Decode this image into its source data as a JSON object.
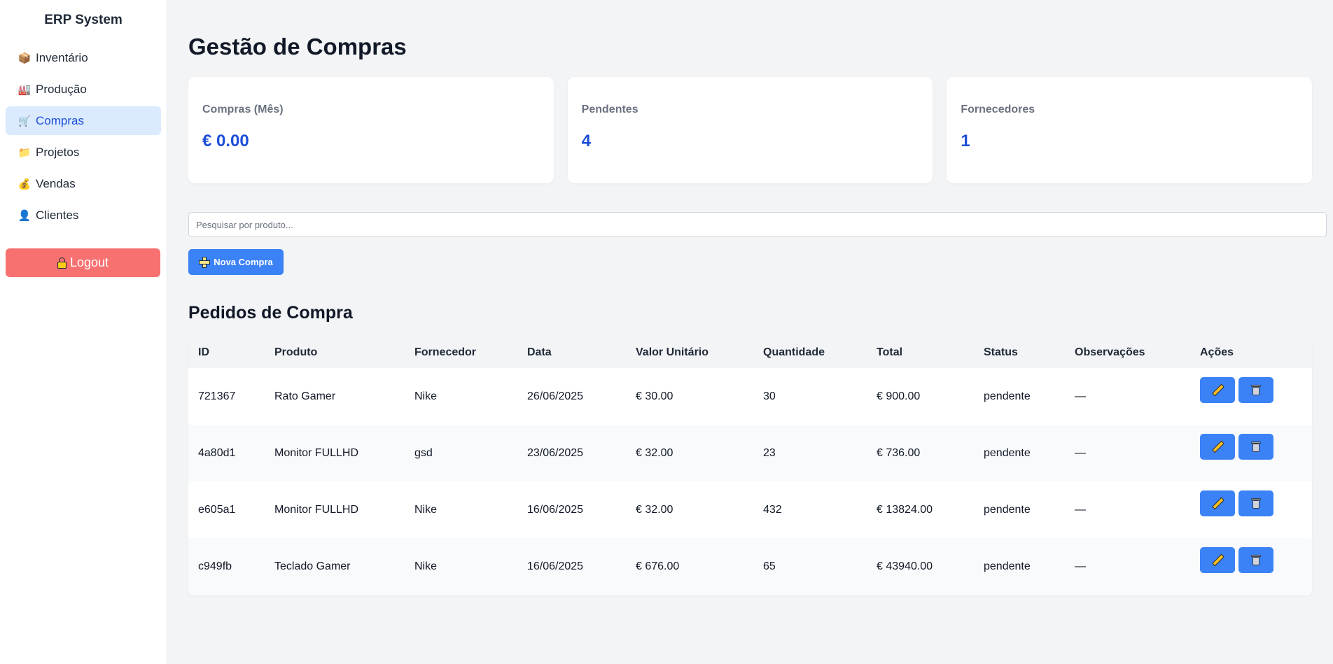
{
  "sidebar": {
    "brand": "ERP System",
    "items": [
      {
        "label": "Inventário",
        "icon": "box-icon"
      },
      {
        "label": "Produção",
        "icon": "factory-icon"
      },
      {
        "label": "Compras",
        "icon": "cart-icon",
        "active": true
      },
      {
        "label": "Projetos",
        "icon": "folder-icon"
      },
      {
        "label": "Vendas",
        "icon": "money-bag-icon"
      },
      {
        "label": "Clientes",
        "icon": "person-icon"
      }
    ],
    "logout_label": "Logout"
  },
  "page": {
    "title": "Gestão de Compras",
    "section_title": "Pedidos de Compra"
  },
  "stats": [
    {
      "label": "Compras (Mês)",
      "value": "€ 0.00"
    },
    {
      "label": "Pendentes",
      "value": "4"
    },
    {
      "label": "Fornecedores",
      "value": "1"
    }
  ],
  "search": {
    "placeholder": "Pesquisar por produto...",
    "value": ""
  },
  "toolbar": {
    "new_label": "Nova Compra"
  },
  "table": {
    "headers": [
      "ID",
      "Produto",
      "Fornecedor",
      "Data",
      "Valor Unitário",
      "Quantidade",
      "Total",
      "Status",
      "Observações",
      "Ações"
    ],
    "rows": [
      [
        "721367",
        "Rato Gamer",
        "Nike",
        "26/06/2025",
        "€ 30.00",
        "30",
        "€ 900.00",
        "pendente",
        "—"
      ],
      [
        "4a80d1",
        "Monitor FULLHD",
        "gsd",
        "23/06/2025",
        "€ 32.00",
        "23",
        "€ 736.00",
        "pendente",
        "—"
      ],
      [
        "e605a1",
        "Monitor FULLHD",
        "Nike",
        "16/06/2025",
        "€ 32.00",
        "432",
        "€ 13824.00",
        "pendente",
        "—"
      ],
      [
        "c949fb",
        "Teclado Gamer",
        "Nike",
        "16/06/2025",
        "€ 676.00",
        "65",
        "€ 43940.00",
        "pendente",
        "—"
      ]
    ]
  },
  "colors": {
    "accent": "#3b82f6",
    "accent_text": "#1d4ed8",
    "active_bg": "#dbeafe",
    "logout": "#f87171"
  }
}
